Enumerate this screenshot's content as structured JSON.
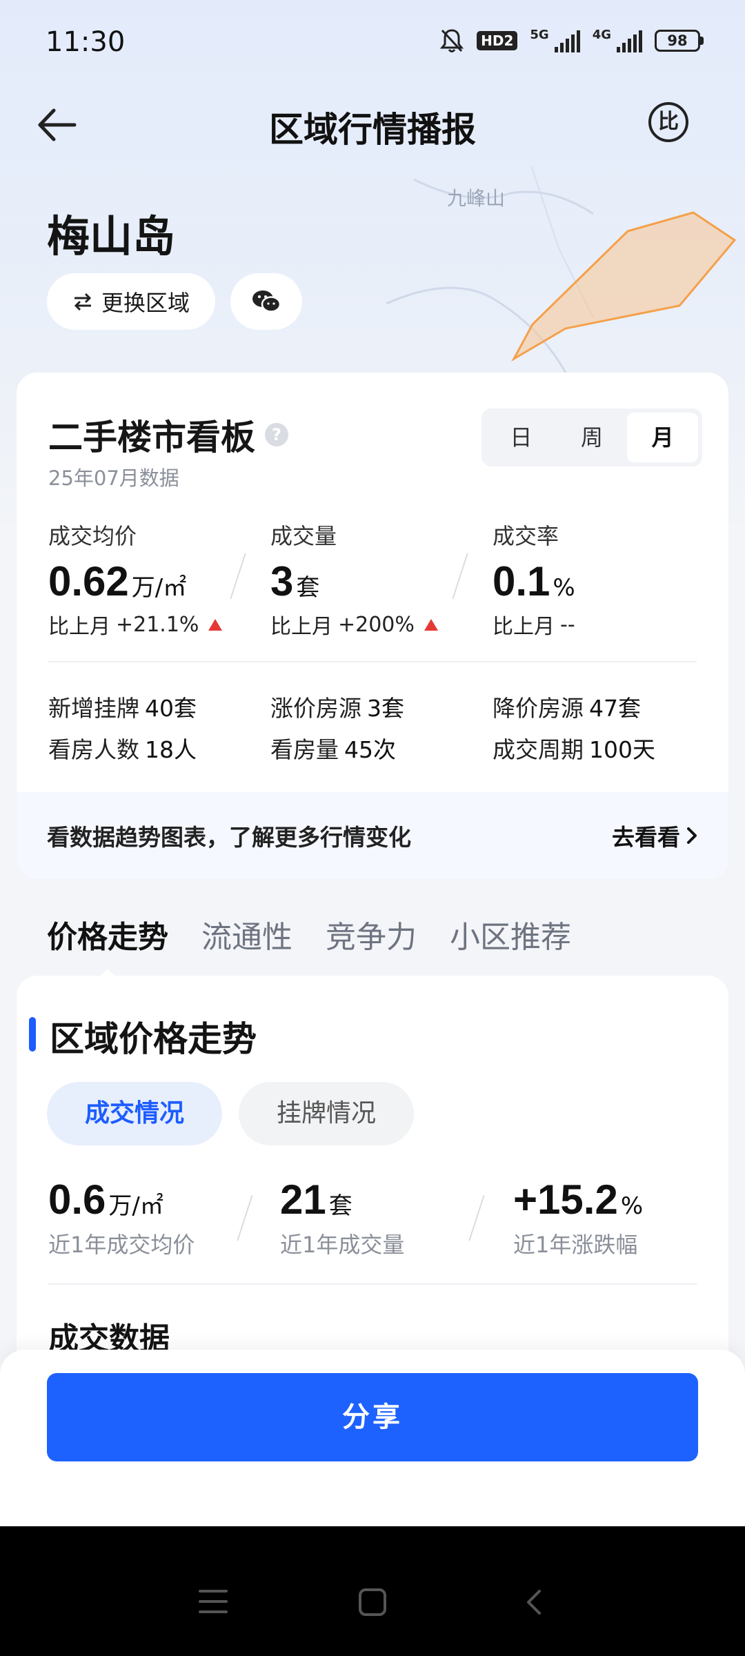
{
  "status_bar": {
    "time": "11:30",
    "hd": "HD2",
    "net1": "5G",
    "net2": "4G",
    "battery": "98"
  },
  "header": {
    "title": "区域行情播报",
    "brand_icon": "比"
  },
  "map": {
    "label": "九峰山",
    "highlight_color": "#f5a04a"
  },
  "region": {
    "name": "梅山岛",
    "switch_label": "更换区域"
  },
  "board": {
    "title": "二手楼市看板",
    "subtitle": "25年07月数据",
    "segments": [
      "日",
      "周",
      "月"
    ],
    "active_segment": "月",
    "metrics": [
      {
        "label": "成交均价",
        "value": "0.62",
        "unit": "万/㎡",
        "change_prefix": "比上月",
        "change": "+21.1%",
        "trend": "up"
      },
      {
        "label": "成交量",
        "value": "3",
        "unit": "套",
        "change_prefix": "比上月",
        "change": "+200%",
        "trend": "up"
      },
      {
        "label": "成交率",
        "value": "0.1",
        "unit": "%",
        "change_prefix": "比上月",
        "change": "--",
        "trend": "none"
      }
    ],
    "stats": [
      {
        "label": "新增挂牌",
        "value": "40套"
      },
      {
        "label": "涨价房源",
        "value": "3套"
      },
      {
        "label": "降价房源",
        "value": "47套"
      },
      {
        "label": "看房人数",
        "value": "18人"
      },
      {
        "label": "看房量",
        "value": "45次"
      },
      {
        "label": "成交周期",
        "value": "100天"
      }
    ],
    "footer_tip": "看数据趋势图表，了解更多行情变化",
    "footer_link": "去看看"
  },
  "tabs": [
    "价格走势",
    "流通性",
    "竞争力",
    "小区推荐"
  ],
  "price_section": {
    "title": "区域价格走势",
    "pills": [
      "成交情况",
      "挂牌情况"
    ],
    "kpis": [
      {
        "value": "0.6",
        "unit": "万/㎡",
        "label": "近1年成交均价"
      },
      {
        "value": "21",
        "unit": "套",
        "label": "近1年成交量"
      },
      {
        "value": "+15.2",
        "unit": "%",
        "label": "近1年涨跌幅"
      }
    ],
    "subtitle": "成交数据"
  },
  "share_button": "分享",
  "colors": {
    "accent": "#1d62ff",
    "up": "#e53935"
  }
}
